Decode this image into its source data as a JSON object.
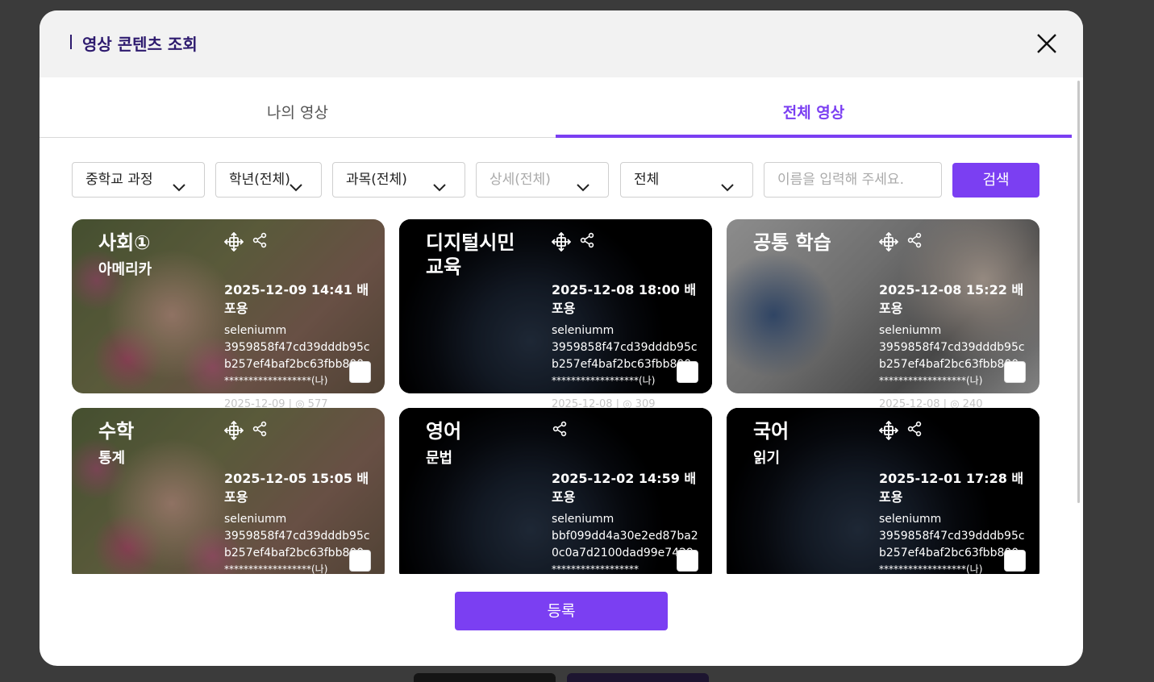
{
  "modal": {
    "title": "영상 콘텐츠 조회",
    "tabs": [
      {
        "label": "나의 영상",
        "active": false
      },
      {
        "label": "전체 영상",
        "active": true
      }
    ]
  },
  "filters": {
    "course": "중학교 과정",
    "grade": "학년(전체)",
    "subject": "과목(전체)",
    "detail": "상세(전체)",
    "scope": "전체",
    "search_placeholder": "이름을 입력해 주세요.",
    "search_label": "검색"
  },
  "cards": [
    {
      "subject": "사회①",
      "detail": "아메리카",
      "date": "2025-12-09 14:41 배포용",
      "author": "seleniumm",
      "hash": "3959858f47cd39dddb95cb257ef4baf2bc63fbb800",
      "masked": "******************(나)",
      "bg": "flowers",
      "under": "2025-12-09 | ◎ 577"
    },
    {
      "subject": "디지털시민 교육",
      "detail": "",
      "date": "2025-12-08 18:00 배포용",
      "author": "seleniumm",
      "hash": "3959858f47cd39dddb95cb257ef4baf2bc63fbb800",
      "masked": "******************(나)",
      "bg": "earth",
      "under": "2025-12-08 | ◎ 309"
    },
    {
      "subject": "공통 학습",
      "detail": "",
      "date": "2025-12-08 15:22 배포용",
      "author": "seleniumm",
      "hash": "3959858f47cd39dddb95cb257ef4baf2bc63fbb800",
      "masked": "******************(나)",
      "bg": "lab",
      "under": "2025-12-08 | ◎ 240"
    },
    {
      "subject": "수학",
      "detail": "통계",
      "date": "2025-12-05 15:05 배포용",
      "author": "seleniumm",
      "hash": "3959858f47cd39dddb95cb257ef4baf2bc63fbb800",
      "masked": "******************(나)",
      "bg": "flowers",
      "under": ""
    },
    {
      "subject": "영어",
      "detail": "문법",
      "date": "2025-12-02 14:59 배포용",
      "author": "seleniumm",
      "hash": "bbf099dd4a30e2ed87ba20c0a7d2100dad99e7429",
      "masked": "******************",
      "bg": "earth",
      "under": ""
    },
    {
      "subject": "국어",
      "detail": "읽기",
      "date": "2025-12-01 17:28 배포용",
      "author": "seleniumm",
      "hash": "3959858f47cd39dddb95cb257ef4baf2bc63fbb800",
      "masked": "******************(나)",
      "bg": "earth",
      "under": ""
    }
  ],
  "footer": {
    "submit_label": "등록"
  },
  "colors": {
    "accent": "#7b3ff2",
    "title": "#2d1a6e"
  }
}
